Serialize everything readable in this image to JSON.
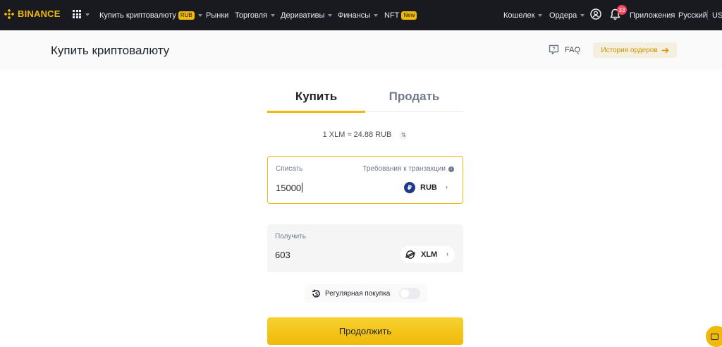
{
  "brand": {
    "name": "BINANCE",
    "accent": "#f0b90b"
  },
  "nav": {
    "buy_crypto": "Купить криптовалюту",
    "buy_crypto_badge": "RUB",
    "markets": "Рынки",
    "trade": "Торговля",
    "derivatives": "Деривативы",
    "finance": "Финансы",
    "nft": "NFT",
    "nft_badge": "New",
    "wallet": "Кошелек",
    "orders": "Ордера",
    "notifications_count": "33",
    "apps": "Приложения",
    "language": "Русский",
    "currency": "US"
  },
  "header": {
    "title": "Купить криптовалюту",
    "faq": "FAQ",
    "order_history": "История ордеров"
  },
  "tabs": [
    {
      "label": "Купить",
      "active": true
    },
    {
      "label": "Продать",
      "active": false
    }
  ],
  "rate": "1 XLM ≈ 24.88 RUB",
  "spend": {
    "label": "Списать",
    "requirements": "Требования к транзакции",
    "value": "15000",
    "currency": "RUB"
  },
  "receive": {
    "label": "Получить",
    "value": "603",
    "currency": "XLM"
  },
  "recurring": {
    "label": "Регулярная покупка",
    "enabled": false
  },
  "continue_label": "Продолжить",
  "icons": [
    "apps-grid-icon",
    "profile-icon",
    "bell-icon",
    "faq-icon",
    "arrow-right-icon",
    "swap-icon",
    "info-icon",
    "rub-icon",
    "xlm-icon",
    "recurring-icon",
    "chat-icon"
  ]
}
